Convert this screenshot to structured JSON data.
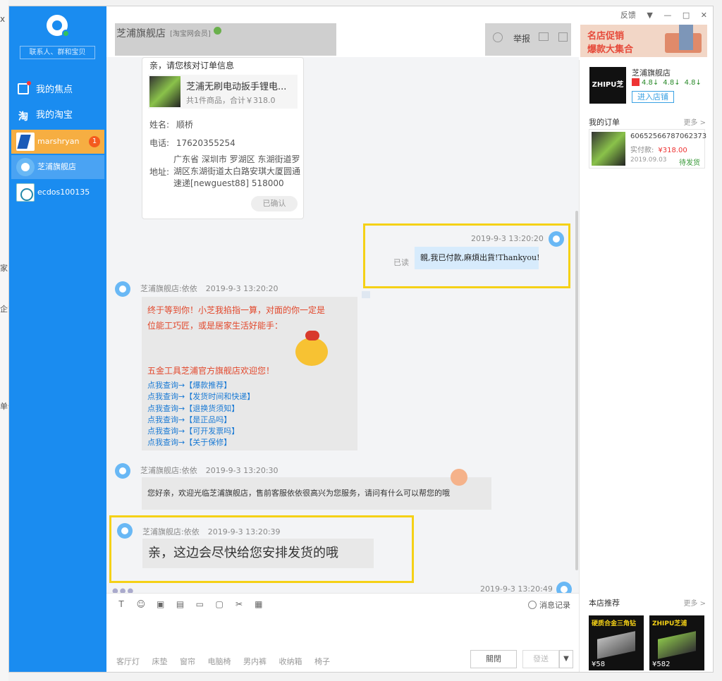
{
  "behind": {
    "close": "x",
    "fragments": [
      "家",
      "企家",
      "单仿"
    ]
  },
  "sidebar": {
    "search_placeholder": "联系人、群和宝贝",
    "nav": [
      {
        "label": "我的焦点",
        "icon": "focus-icon"
      },
      {
        "label": "我的淘宝",
        "icon": "taobao-icon"
      }
    ],
    "contacts": [
      {
        "name": "marshryan",
        "badge": "1",
        "state": "active"
      },
      {
        "name": "芝浦旗舰店",
        "state": "current"
      },
      {
        "name": "ecdos100135",
        "state": "normal"
      }
    ]
  },
  "titlebar": {
    "shop": "芝浦旗舰店",
    "tag": "[淘宝网会员]",
    "report": "举报",
    "promo_line1": "名店促销",
    "promo_line2": "爆款大集合",
    "controls": [
      "反馈",
      "▼",
      "—",
      "□",
      "✕"
    ]
  },
  "chat": {
    "order_card": {
      "header": "亲，请您核对订单信息",
      "product_name": "芝浦无刷电动扳手锂电...",
      "product_sum": "共1件商品，合计￥318.0",
      "name_label": "姓名:",
      "name": "顺桥",
      "phone_label": "电话:",
      "phone": "17620355254",
      "addr_label": "地址:",
      "address": "广东省 深圳市 罗湖区 东湖街道罗湖区东湖街道太白路安琪大厦圆通速递[newguest88] 518000",
      "confirmed": "已确认"
    },
    "my_message": {
      "time": "2019-9-3 13:20:20",
      "read": "已读",
      "text": "親,我已付款,麻煩出貨!Thankyou!"
    },
    "welcome_message": {
      "sender": "芝浦旗舰店:依依",
      "time": "2019-9-3 13:20:20",
      "line1": "终于等到你！小芝我掐指一算，对面的你一定是",
      "line2": "位能工巧匠，或是居家生活好能手：",
      "line3": "五金工具芝浦官方旗舰店欢迎您！",
      "links": [
        "点我查询→【爆款推荐】",
        "点我查询→【发货时间和快递】",
        "点我查询→【退换货须知】",
        "点我查询→【是正品吗】",
        "点我查询→【可开发票吗】",
        "点我查询→【关于保修】"
      ]
    },
    "hello_message": {
      "sender": "芝浦旗舰店:依依",
      "time": "2019-9-3 13:20:30",
      "text": "您好亲，欢迎光临芝浦旗舰店，售前客服依依很高兴为您服务，请问有什么可以帮您的哦"
    },
    "ship_message": {
      "sender": "芝浦旗舰店:依依",
      "time": "2019-9-3 13:20:39",
      "text": "亲，这边会尽快给您安排发货的哦"
    },
    "last_time": "2019-9-3 13:20:49"
  },
  "input": {
    "history": "消息记录",
    "quick_words": [
      "客厅灯",
      "床垫",
      "窗帘",
      "电脑椅",
      "男内裤",
      "收纳箱",
      "椅子"
    ],
    "close_label": "關閉",
    "send_label": "發送",
    "send_dropdown": "▼"
  },
  "right_panel": {
    "shop_logo": "ZHIPU芝浦",
    "shop_name": "芝浦旗舰店",
    "ratings": [
      "4.8↓",
      "4.8↓",
      "4.8↓"
    ],
    "enter_shop": "进入店铺",
    "orders_title": "我的订单",
    "more": "更多 >",
    "order": {
      "number": "60652566787062373",
      "paid_label": "实付款:",
      "paid": "¥318.00",
      "date": "2019.09.03",
      "status": "待发货"
    },
    "rec_title": "本店推荐",
    "recs": [
      {
        "title": "硬质合金三角钻",
        "price": "¥58"
      },
      {
        "title": "ZHIPU芝浦",
        "price": "¥582"
      }
    ]
  }
}
